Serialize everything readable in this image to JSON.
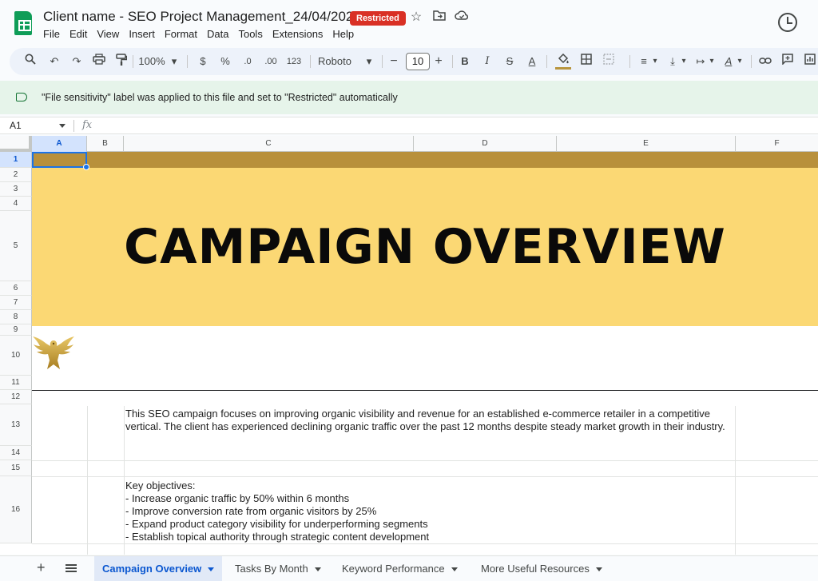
{
  "window": {
    "doc_title": "Client name - SEO Project Management_24/04/2025",
    "badge": "Restricted"
  },
  "menu": [
    "File",
    "Edit",
    "View",
    "Insert",
    "Format",
    "Data",
    "Tools",
    "Extensions",
    "Help"
  ],
  "toolbar": {
    "zoom": "100%",
    "currency": "$",
    "percent": "%",
    "decrease_decimal": ".0",
    "increase_decimal": ".00",
    "number_format": "123",
    "font": "Roboto",
    "font_size": "10",
    "bold": "B",
    "italic": "I",
    "text_color": "A",
    "fill_color": "#b8953e"
  },
  "banner": {
    "text": "\"File sensitivity\" label was applied to this file and set to \"Restricted\" automatically"
  },
  "formula_bar": {
    "cell_ref": "A1",
    "fx": "fx"
  },
  "grid": {
    "columns": [
      "A",
      "B",
      "C",
      "D",
      "E",
      "F"
    ],
    "rows": [
      "1",
      "2",
      "3",
      "4",
      "5",
      "6",
      "7",
      "8",
      "9",
      "10",
      "11",
      "12",
      "13",
      "14",
      "15",
      "16"
    ],
    "hero_title": "CAMPAIGN OVERVIEW",
    "intro_text": "This SEO campaign focuses on improving organic visibility and revenue for an established e-commerce retailer in a competitive vertical. The client has experienced declining organic traffic over the past 12 months despite steady market growth in their industry.",
    "objectives_text": "Key objectives:\n- Increase organic traffic by 50% within 6 months\n- Improve conversion rate from organic visitors by 25%\n- Expand product category visibility for underperforming segments\n- Establish topical authority through strategic content development",
    "colors": {
      "gold_band": "#b8903b",
      "yellow_band": "#fbd874",
      "logo_gold": "#c9a227"
    }
  },
  "sheet_tabs": [
    {
      "label": "Campaign Overview",
      "active": true
    },
    {
      "label": "Tasks By Month",
      "active": false
    },
    {
      "label": "Keyword Performance",
      "active": false
    },
    {
      "label": "More Useful Resources",
      "active": false
    }
  ]
}
